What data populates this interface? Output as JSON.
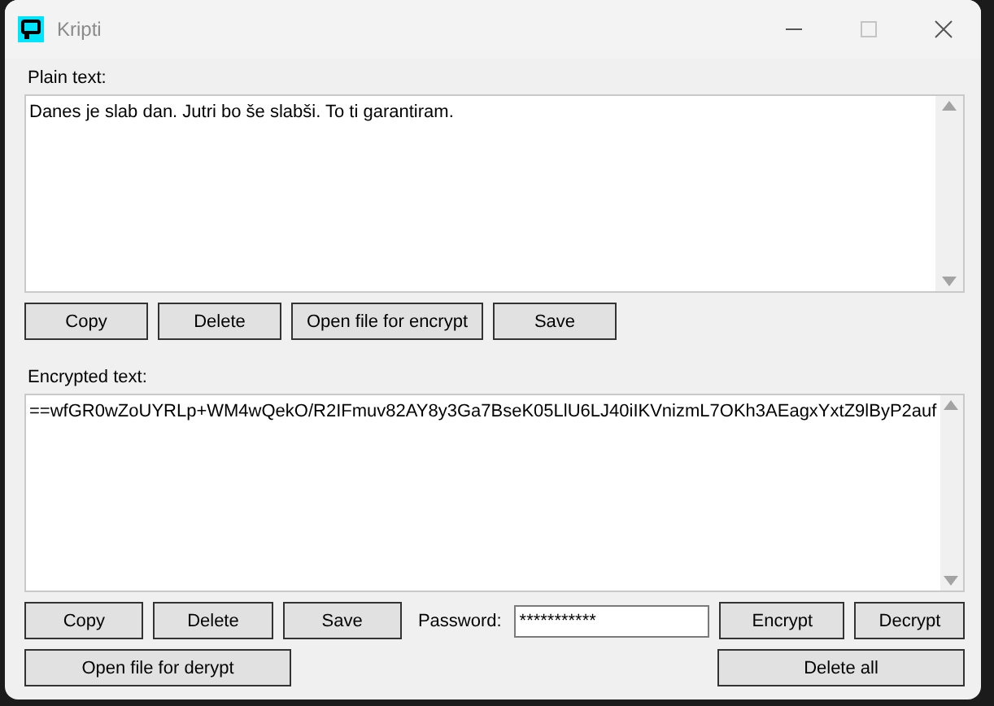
{
  "window": {
    "title": "Kripti"
  },
  "plain": {
    "label": "Plain text:",
    "value": "Danes je slab dan. Jutri bo še slabši. To ti garantiram.",
    "buttons": [
      "Copy",
      "Delete",
      "Open file for encrypt",
      "Save"
    ]
  },
  "encrypted": {
    "label": "Encrypted text:",
    "value": "==wfGR0wZoUYRLp+WM4wQekO/R2IFmuv82AY8y3Ga7BseK05LlU6LJ40iIKVnizmL7OKh3AEagxYxtZ9lByP2auf",
    "buttons": [
      "Copy",
      "Delete",
      "Save"
    ]
  },
  "password": {
    "label": "Password:",
    "value": "***********"
  },
  "actions": [
    "Encrypt",
    "Decrypt"
  ],
  "bottom": {
    "open_button": "Open file for derypt",
    "delete_all_button": "Delete all"
  }
}
